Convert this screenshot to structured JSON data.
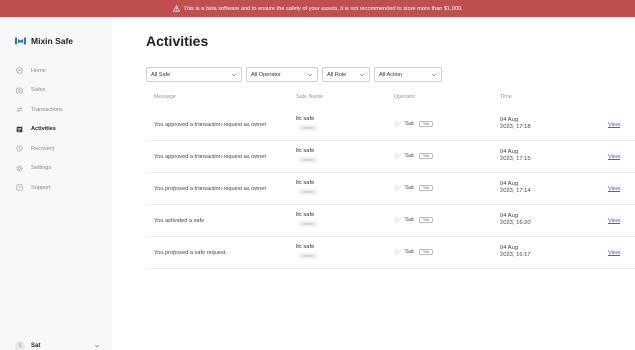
{
  "banner": {
    "text": "This is a beta software and to ensure the safety of your assets, it is not recommended to store more than $1,000.",
    "icon": "warning-icon"
  },
  "app": {
    "name": "Mixin Safe",
    "logo": "mixin-logo-icon"
  },
  "nav": [
    {
      "label": "Home",
      "icon": "home-icon",
      "active": false
    },
    {
      "label": "Safes",
      "icon": "safe-icon",
      "active": false
    },
    {
      "label": "Transactions",
      "icon": "transactions-icon",
      "active": false
    },
    {
      "label": "Activities",
      "icon": "activities-icon",
      "active": true
    },
    {
      "label": "Recovery",
      "icon": "recovery-icon",
      "active": false
    },
    {
      "label": "Settings",
      "icon": "settings-icon",
      "active": false
    },
    {
      "label": "Support",
      "icon": "support-icon",
      "active": false
    }
  ],
  "user": {
    "name": "Sat",
    "avatar_letter": "S"
  },
  "page": {
    "title": "Activities"
  },
  "filters": {
    "safe": "All Safe",
    "operator": "All Operator",
    "role": "All Role",
    "action": "All Action"
  },
  "table": {
    "headers": {
      "message": "Message",
      "safe": "Safe Name",
      "operator": "Operator",
      "time": "Time"
    },
    "rows": [
      {
        "message": "You approved a transaction request as owner",
        "safe": "ltc safe",
        "role": "Owner",
        "operator": "Sat",
        "you": "You",
        "avatar": "S",
        "time_date": "04 Aug",
        "time_clock": "2023, 17:18",
        "action": "View"
      },
      {
        "message": "You approved a transaction request as owner",
        "safe": "ltc safe",
        "role": "Owner",
        "operator": "Sat",
        "you": "You",
        "avatar": "S",
        "time_date": "04 Aug",
        "time_clock": "2023, 17:15",
        "action": "View"
      },
      {
        "message": "You proposed a transaction request as owner",
        "safe": "ltc safe",
        "role": "Owner",
        "operator": "Sat",
        "you": "You",
        "avatar": "S",
        "time_date": "04 Aug",
        "time_clock": "2023, 17:14",
        "action": "View"
      },
      {
        "message": "You activated a safe",
        "safe": "ltc safe",
        "role": "Owner",
        "operator": "Sat",
        "you": "You",
        "avatar": "S",
        "time_date": "04 Aug",
        "time_clock": "2023, 16:20",
        "action": "View"
      },
      {
        "message": "You proposed a safe request",
        "safe": "ltc safe",
        "role": "Owner",
        "operator": "Sat",
        "you": "You",
        "avatar": "S",
        "time_date": "04 Aug",
        "time_clock": "2023, 16:17",
        "action": "View"
      }
    ]
  },
  "colors": {
    "banner": "#c0504f",
    "link": "#3c64d8",
    "logo_blue": "#2f6de0"
  }
}
